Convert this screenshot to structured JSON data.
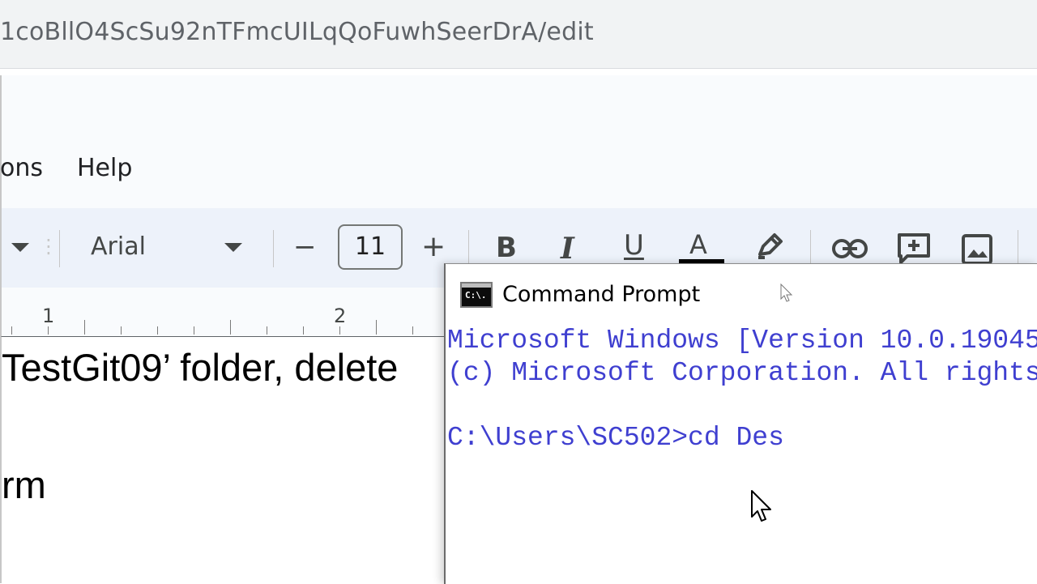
{
  "browser": {
    "url_fragment": "1coBllO4ScSu92nTFmcUILqQoFuwhSeerDrA/edit"
  },
  "menu": {
    "items": [
      {
        "label": "ons"
      },
      {
        "label": "Help"
      }
    ]
  },
  "toolbar": {
    "font_name": "Arial",
    "font_size": "11",
    "decrease_label": "−",
    "increase_label": "+",
    "bold_label": "B",
    "italic_label": "I",
    "underline_label": "U",
    "text_color_label": "A"
  },
  "ruler": {
    "marks": [
      "1",
      "2"
    ]
  },
  "document": {
    "lines": [
      "TestGit09’ folder, delete",
      "rm"
    ]
  },
  "cmd": {
    "icon_text": "C:\\.",
    "title": "Command Prompt",
    "lines": [
      "Microsoft Windows [Version 10.0.19045",
      "(c) Microsoft Corporation. All rights",
      "",
      "C:\\Users\\SC502>cd Des"
    ]
  },
  "colors": {
    "cmd_text": "#3f3fd0",
    "toolbar_bg": "#edf2fa",
    "header_bg": "#f9fbfd"
  }
}
